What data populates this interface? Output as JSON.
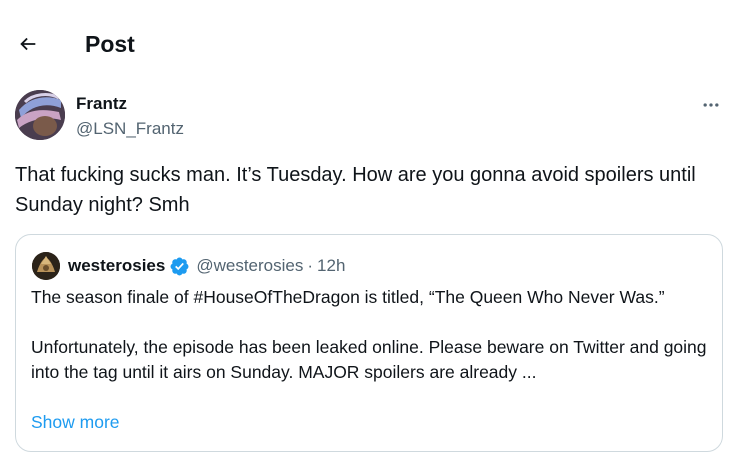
{
  "header": {
    "back_icon": "arrow-left-icon",
    "title": "Post"
  },
  "post": {
    "author": {
      "name": "Frantz",
      "handle": "@LSN_Frantz"
    },
    "more_icon": "more-horizontal-icon",
    "text": "That fucking sucks man. It’s Tuesday. How are you gonna avoid spoilers until Sunday night? Smh"
  },
  "quote": {
    "author": {
      "name": "westerosies",
      "verified_icon": "verified-badge-icon",
      "handle": "@westerosies",
      "separator": "·",
      "time": "12h"
    },
    "paragraph_1": "The season finale of #HouseOfTheDragon is titled, “The Queen Who Never Was.”",
    "paragraph_2": "Unfortunately, the episode has been leaked online. Please beware on Twitter and going into the tag until it airs on Sunday. MAJOR spoilers are already ...",
    "show_more": "Show more"
  },
  "colors": {
    "text_primary": "#0f1419",
    "text_secondary": "#536471",
    "link": "#1d9bf0",
    "border": "#cfd9de",
    "verified": "#1d9bf0"
  }
}
